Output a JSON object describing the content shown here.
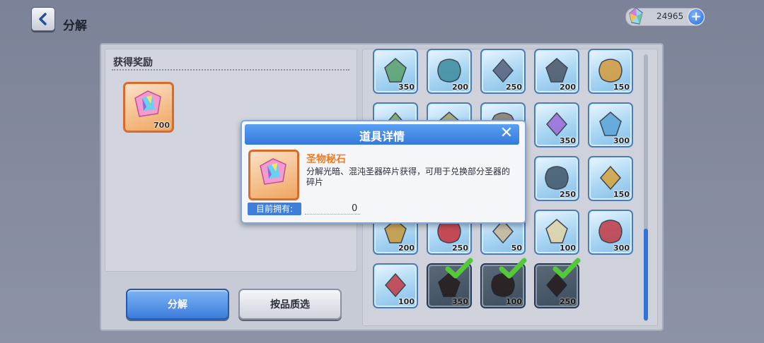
{
  "header": {
    "title": "分解",
    "currency_value": "24965"
  },
  "reward_panel": {
    "title": "获得奖励",
    "reward_count": "700"
  },
  "grid": {
    "items": [
      {
        "count": "350",
        "icon": "bow-icon",
        "owned": false
      },
      {
        "count": "200",
        "icon": "trident-icon",
        "owned": false
      },
      {
        "count": "250",
        "icon": "dark-crest-icon",
        "owned": false
      },
      {
        "count": "200",
        "icon": "spiked-armor-icon",
        "owned": false
      },
      {
        "count": "150",
        "icon": "gold-earring-icon",
        "owned": false
      },
      {
        "count": "",
        "icon": "vine-icon",
        "owned": false
      },
      {
        "count": "",
        "icon": "chain-icon",
        "owned": false
      },
      {
        "count": "",
        "icon": "bracelet-icon",
        "owned": false
      },
      {
        "count": "350",
        "icon": "purple-flower-icon",
        "owned": false
      },
      {
        "count": "300",
        "icon": "goggles-icon",
        "owned": false
      },
      {
        "count": "",
        "icon": "hidden-icon",
        "owned": false
      },
      {
        "count": "",
        "icon": "hidden-icon",
        "owned": false
      },
      {
        "count": "",
        "icon": "hidden-icon",
        "owned": false
      },
      {
        "count": "250",
        "icon": "clock-icon",
        "owned": false
      },
      {
        "count": "150",
        "icon": "gold-crown-icon",
        "owned": false
      },
      {
        "count": "200",
        "icon": "gold-necklace-icon",
        "owned": false
      },
      {
        "count": "250",
        "icon": "ruby-pendant-icon",
        "owned": false
      },
      {
        "count": "50",
        "icon": "feather-icon",
        "owned": false
      },
      {
        "count": "100",
        "icon": "white-flower-icon",
        "owned": false
      },
      {
        "count": "300",
        "icon": "red-crystal-icon",
        "owned": false
      },
      {
        "count": "100",
        "icon": "ruby-chain-icon",
        "owned": false
      },
      {
        "count": "350",
        "icon": "dark-ring-icon",
        "owned": true
      },
      {
        "count": "100",
        "icon": "dark-ring-icon",
        "owned": true
      },
      {
        "count": "250",
        "icon": "dark-cuff-icon",
        "owned": true
      }
    ]
  },
  "buttons": {
    "decompose": "分解",
    "filter": "按品质选"
  },
  "modal": {
    "title": "道具详情",
    "item_name": "圣物秘石",
    "item_desc": "分解光暗、混沌圣器碎片获得，可用于兑换部分圣器的碎片",
    "owned_label": "目前拥有:",
    "owned_value": "0"
  },
  "colors": {
    "accent": "#3d7fdb",
    "item_name": "#f07a22",
    "check": "#55c83a"
  }
}
